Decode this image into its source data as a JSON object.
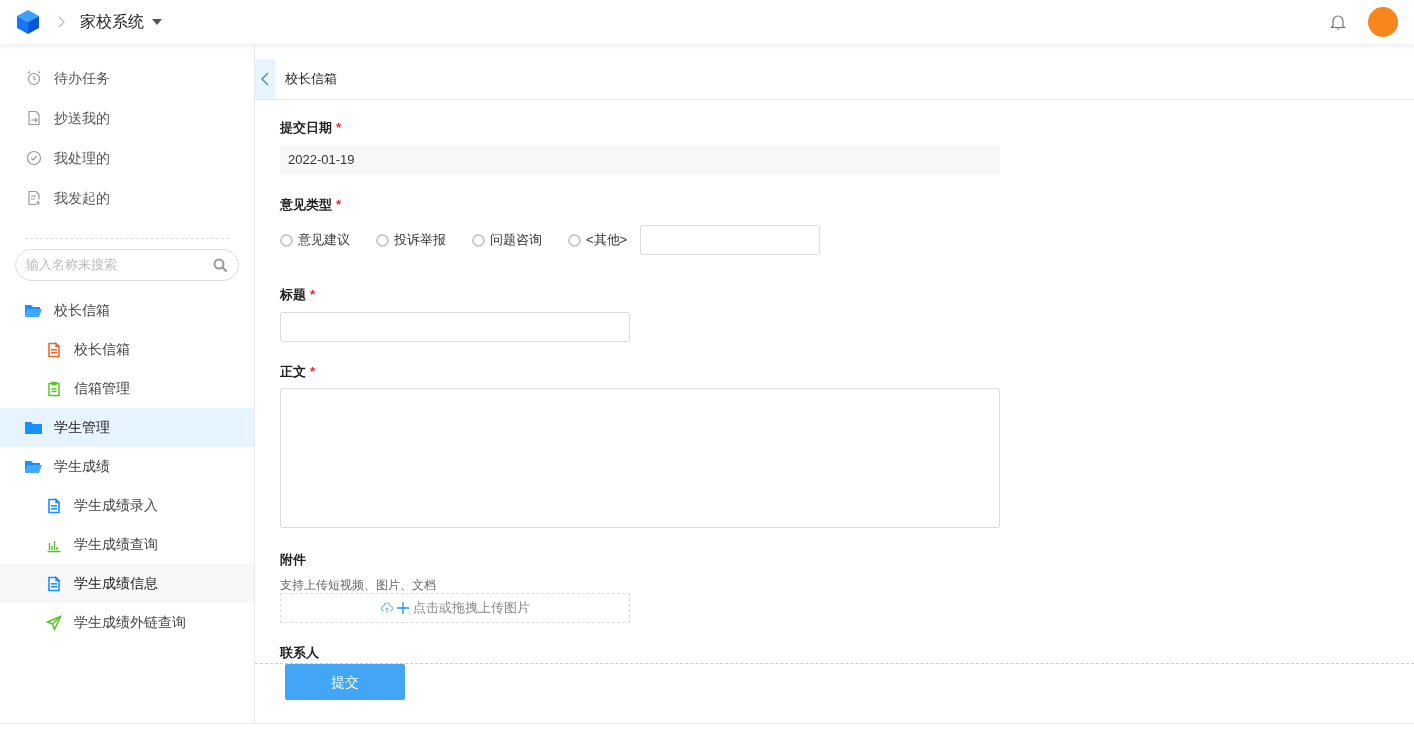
{
  "header": {
    "app_name": "家校系统"
  },
  "sidebar": {
    "shortcuts": [
      {
        "kind": "clock",
        "label": "待办任务"
      },
      {
        "kind": "cc",
        "label": "抄送我的"
      },
      {
        "kind": "check",
        "label": "我处理的"
      },
      {
        "kind": "start",
        "label": "我发起的"
      }
    ],
    "search": {
      "placeholder": "输入名称来搜索"
    },
    "tree": [
      {
        "label": "校长信箱",
        "expanded": true,
        "selected": false,
        "children": [
          {
            "label": "校长信箱",
            "kind": "doc",
            "color": "#f5642d",
            "hovered": false
          },
          {
            "label": "信箱管理",
            "kind": "clipboard",
            "color": "#52c41a",
            "hovered": false
          }
        ]
      },
      {
        "label": "学生管理",
        "expanded": false,
        "selected": true
      },
      {
        "label": "学生成绩",
        "expanded": true,
        "selected": false,
        "children": [
          {
            "label": "学生成绩录入",
            "kind": "doc",
            "color": "#1890ff",
            "hovered": false
          },
          {
            "label": "学生成绩查询",
            "kind": "chart",
            "color": "#52c41a",
            "hovered": false
          },
          {
            "label": "学生成绩信息",
            "kind": "doc",
            "color": "#1890ff",
            "hovered": true
          },
          {
            "label": "学生成绩外链查询",
            "kind": "send",
            "color": "#52c41a",
            "hovered": false
          }
        ]
      }
    ]
  },
  "page": {
    "title": "校长信箱",
    "form": {
      "date": {
        "label": "提交日期",
        "mark": "*",
        "value": "2022-01-19"
      },
      "type": {
        "label": "意见类型",
        "mark": "*",
        "options": [
          {
            "label": "意见建议",
            "selected": false
          },
          {
            "label": "投诉举报",
            "selected": false
          },
          {
            "label": "问题咨询",
            "selected": false
          },
          {
            "label": "<其他>",
            "selected": false
          }
        ]
      },
      "title": {
        "label": "标题",
        "mark": "*"
      },
      "body": {
        "label": "正文",
        "mark": "*"
      },
      "attachment": {
        "label": "附件",
        "hint": "支持上传短视频、图片、文档",
        "upload_text": "点击或拖拽上传图片"
      },
      "contact": {
        "label": "联系人"
      }
    },
    "submit": "提交"
  }
}
